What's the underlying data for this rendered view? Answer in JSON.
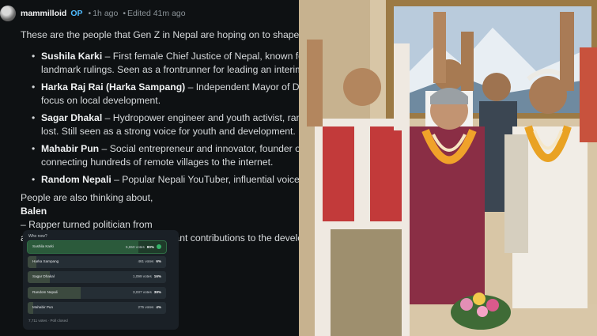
{
  "post": {
    "username": "mammilloid",
    "op_badge": "OP",
    "separator": "•",
    "time": "1h ago",
    "edited": "Edited 41m ago",
    "intro": "These are the people that Gen Z in Nepal are hoping on to shape the",
    "people": [
      {
        "name": "Sushila Karki",
        "line1": " – First female Chief Justice of Nepal, known for h",
        "line2": "landmark rulings. Seen as a frontrunner for leading an interim g"
      },
      {
        "name": "Harka Raj Rai (Harka Sampang)",
        "line1": " – Independent Mayor of Dha",
        "line2": "focus on local development."
      },
      {
        "name": "Sagar Dhakal",
        "line1": " – Hydropower engineer and youth activist, ran as",
        "line2": "lost. Still seen as a strong voice for youth and development."
      },
      {
        "name": "Mahabir Pun",
        "line1": " – Social entrepreneur and innovator, founder of",
        "line2": "connecting hundreds of remote villages to the internet."
      },
      {
        "name": "Random Nepali",
        "line1": " – Popular Nepali YouTuber, influential voice fo",
        "line2": ""
      }
    ],
    "closing_prefix": "People are also thinking about, ",
    "closing_name": "Balen",
    "closing_rest": " – Rapper turned politician from",
    "closing_line2": "and won. Recognized for his significant contributions to the develop"
  },
  "poll": {
    "title": "Who now?",
    "options": [
      {
        "label": "Sushila Karki",
        "votes": "5,650 votes",
        "pct": "80%",
        "fraction": 0.8,
        "winner": true
      },
      {
        "label": "Harka Sampang",
        "votes": "461 votes",
        "pct": "6%",
        "fraction": 0.06,
        "winner": false
      },
      {
        "label": "Sagar Dhakal",
        "votes": "1,099 votes",
        "pct": "16%",
        "fraction": 0.16,
        "winner": false
      },
      {
        "label": "Random Nepali",
        "votes": "3,037 votes",
        "pct": "38%",
        "fraction": 0.38,
        "winner": false
      },
      {
        "label": "Mahabir Pun",
        "votes": "275 votes",
        "pct": "4%",
        "fraction": 0.04,
        "winner": false
      }
    ],
    "footer": "7,711 votes · Poll closed"
  },
  "colors": {
    "background": "#0e1113",
    "op_badge": "#4fbcff",
    "poll_winner": "#2b5a3b",
    "check": "#36b36a"
  }
}
